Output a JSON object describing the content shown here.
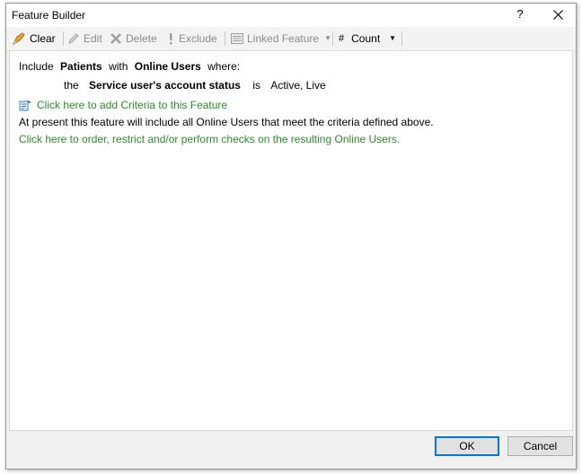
{
  "window": {
    "title": "Feature Builder",
    "help_label": "?",
    "close_icon": "close-icon"
  },
  "toolbar": {
    "clear_label": "Clear",
    "edit_label": "Edit",
    "delete_label": "Delete",
    "exclude_label": "Exclude",
    "linked_feature_label": "Linked Feature",
    "count_label": "Count",
    "count_glyph": "#",
    "dropdown_caret": "▼"
  },
  "content": {
    "include_word": "Include",
    "subject": "Patients",
    "with_word": "with",
    "target": "Online Users",
    "where_word": "where:",
    "criteria": {
      "the_word": "the",
      "field": "Service user's account status",
      "is_word": "is",
      "values": "Active, Live"
    },
    "add_criteria_link": "Click here to add Criteria to this Feature",
    "summary": "At present this feature will include all Online Users that meet the criteria defined above.",
    "order_link": "Click here to order, restrict and/or perform checks on the resulting Online Users."
  },
  "buttons": {
    "ok": "OK",
    "cancel": "Cancel"
  },
  "colors": {
    "link_green": "#2d8a2d",
    "default_button_border": "#0078d7"
  }
}
